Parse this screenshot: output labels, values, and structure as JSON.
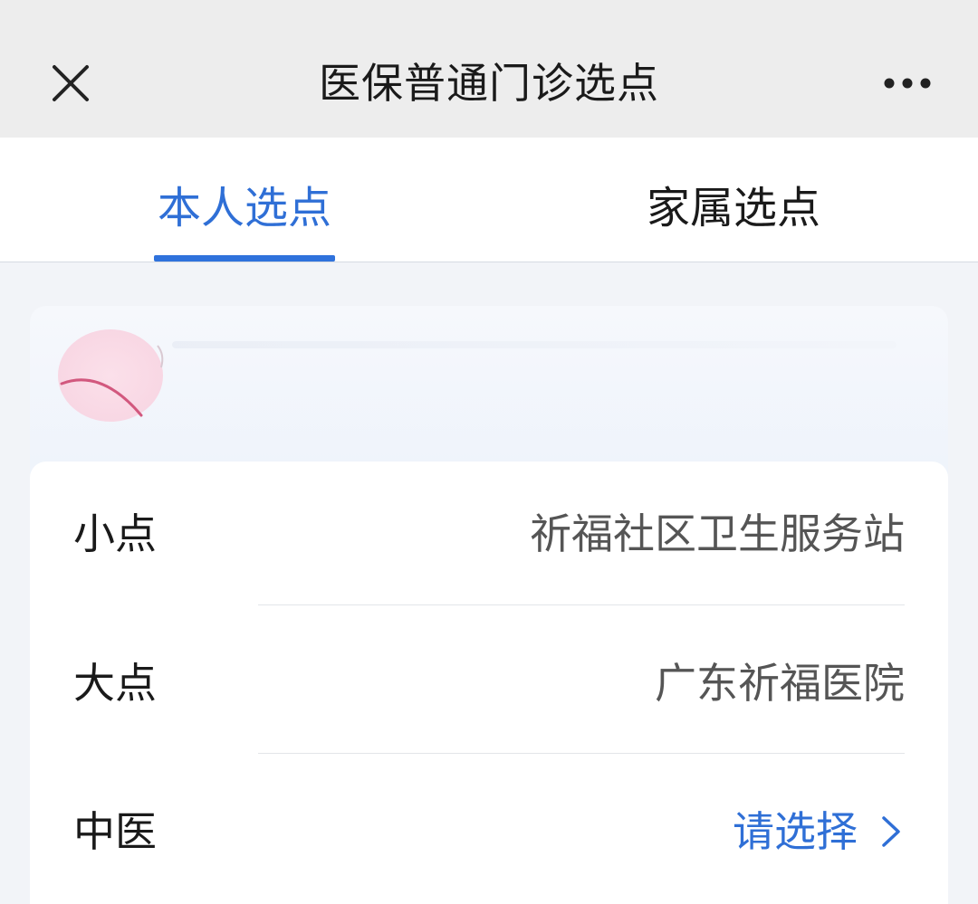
{
  "header": {
    "title": "医保普通门诊选点",
    "close_icon": "close-icon",
    "more_icon": "more-icon"
  },
  "tabs": [
    {
      "label": "本人选点",
      "active": true
    },
    {
      "label": "家属选点",
      "active": false
    }
  ],
  "selection": {
    "rows": [
      {
        "label": "小点",
        "value": "祈福社区卫生服务站"
      },
      {
        "label": "大点",
        "value": "广东祈福医院"
      },
      {
        "label": "中医",
        "value": "请选择"
      }
    ]
  },
  "colors": {
    "accent": "#2f6fd6",
    "title_bar": "#ededed",
    "page_bg": "#f2f4f8"
  }
}
